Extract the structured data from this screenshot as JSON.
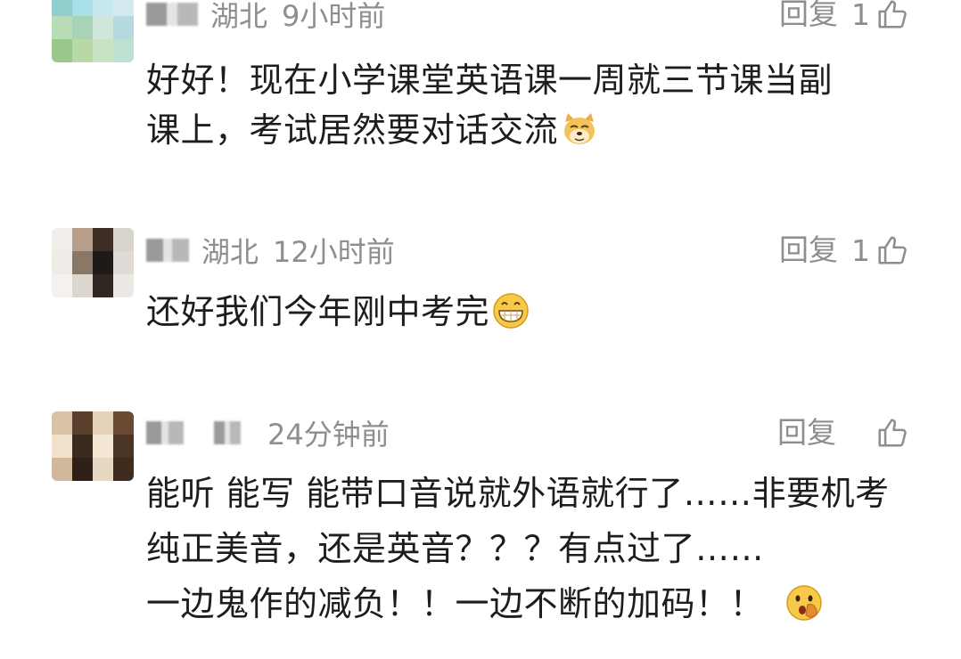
{
  "comments": [
    {
      "location": "湖北",
      "time": "9小时前",
      "reply_label": "回复",
      "likes": "1",
      "lines": [
        "好好！现在小学课堂英语课一周就三节课当副",
        "课上，考试居然要对话交流"
      ],
      "emoji": "doge-emoji",
      "avatar_colors": [
        "#8fd0cf",
        "#a9dfe6",
        "#c6e6f0",
        "#d3e8ef",
        "#b9dbb7",
        "#a7d3b6",
        "#cfe7da",
        "#b6d9df",
        "#98c98b",
        "#b9d8a8",
        "#c7e3c3",
        "#bfe0d0"
      ]
    },
    {
      "location": "湖北",
      "time": "12小时前",
      "reply_label": "回复",
      "likes": "1",
      "lines": [
        "还好我们今年刚中考完"
      ],
      "emoji": "grin-emoji",
      "avatar_colors": [
        "#f1eeea",
        "#b89f8b",
        "#3d2f26",
        "#d9d4ce",
        "#efebe6",
        "#8b7765",
        "#1f1a16",
        "#e0dbd6",
        "#f4f1ee",
        "#dcd6cf",
        "#2e2722",
        "#ebe7e3"
      ]
    },
    {
      "location": "",
      "time": "24分钟前",
      "reply_label": "回复",
      "likes": "",
      "lines": [
        "能听 能写 能带口音说就外语就行了……非要机考",
        "纯正美音，还是英音？？？有点过了……",
        "一边鬼作的减负！！一边不断的加码！！"
      ],
      "emoji": "shocked-emoji",
      "avatar_colors": [
        "#d8c2a8",
        "#5a3f2c",
        "#e6d2b8",
        "#6b4a33",
        "#efe1cc",
        "#3b2a1e",
        "#f3e6d2",
        "#4a3424",
        "#d2b89b",
        "#2d2018",
        "#e8d7c0",
        "#3f2c1f"
      ]
    }
  ]
}
